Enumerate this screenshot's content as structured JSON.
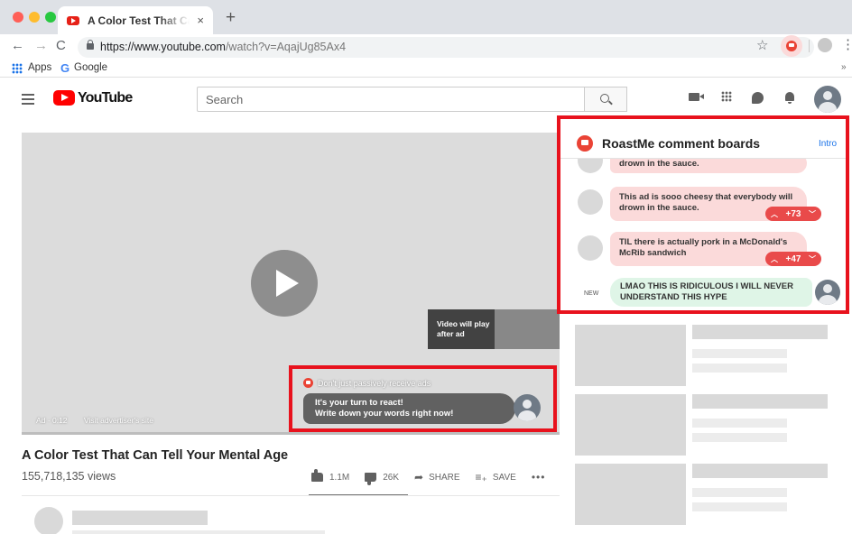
{
  "browser": {
    "tab_title": "A Color Test That Can Tell Your Mental Age",
    "tab_close": "×",
    "new_tab": "+",
    "url_host": "https://www.youtube.com",
    "url_path": "/watch?v=AqajUg85Ax4",
    "bookmarks": [
      "Apps",
      "Google"
    ],
    "bookmarks_more": "»"
  },
  "youtube": {
    "logo_text": "YouTube",
    "search_placeholder": "Search"
  },
  "player": {
    "ad_next_text": [
      "Video will play",
      "after ad"
    ],
    "ad_time": "Ad · 0:12",
    "visit_advertiser": "Visit advertiser's site",
    "prompt_header": "Don't just passively receive ads",
    "prompt_lines": [
      "It's your turn to react!",
      "Write down your words right now!"
    ]
  },
  "video": {
    "title": "A Color Test That Can Tell Your Mental Age",
    "views": "155,718,135 views",
    "likes": "1.1M",
    "dislikes": "26K",
    "share_label": "SHARE",
    "save_label": "SAVE"
  },
  "roastme": {
    "title": "RoastMe comment boards",
    "intro_link": "Intro",
    "comments": [
      {
        "text": "drown in the sauce.",
        "votes": ""
      },
      {
        "text": "This ad is sooo cheesy that everybody will drown in the sauce.",
        "votes": "+73"
      },
      {
        "text": "TIL there is actually pork in a McDonald's McRib sandwich",
        "votes": "+47"
      }
    ],
    "new_label": "NEW",
    "new_comment": "LMAO THIS IS RIDICULOUS I WILL NEVER UNDERSTAND THIS HYPE"
  },
  "icons": {
    "accent_red": "#e8121d",
    "youtube_red": "#ff0000",
    "vote_red": "#e94a4a",
    "new_comment_green": "#dff5e7"
  }
}
